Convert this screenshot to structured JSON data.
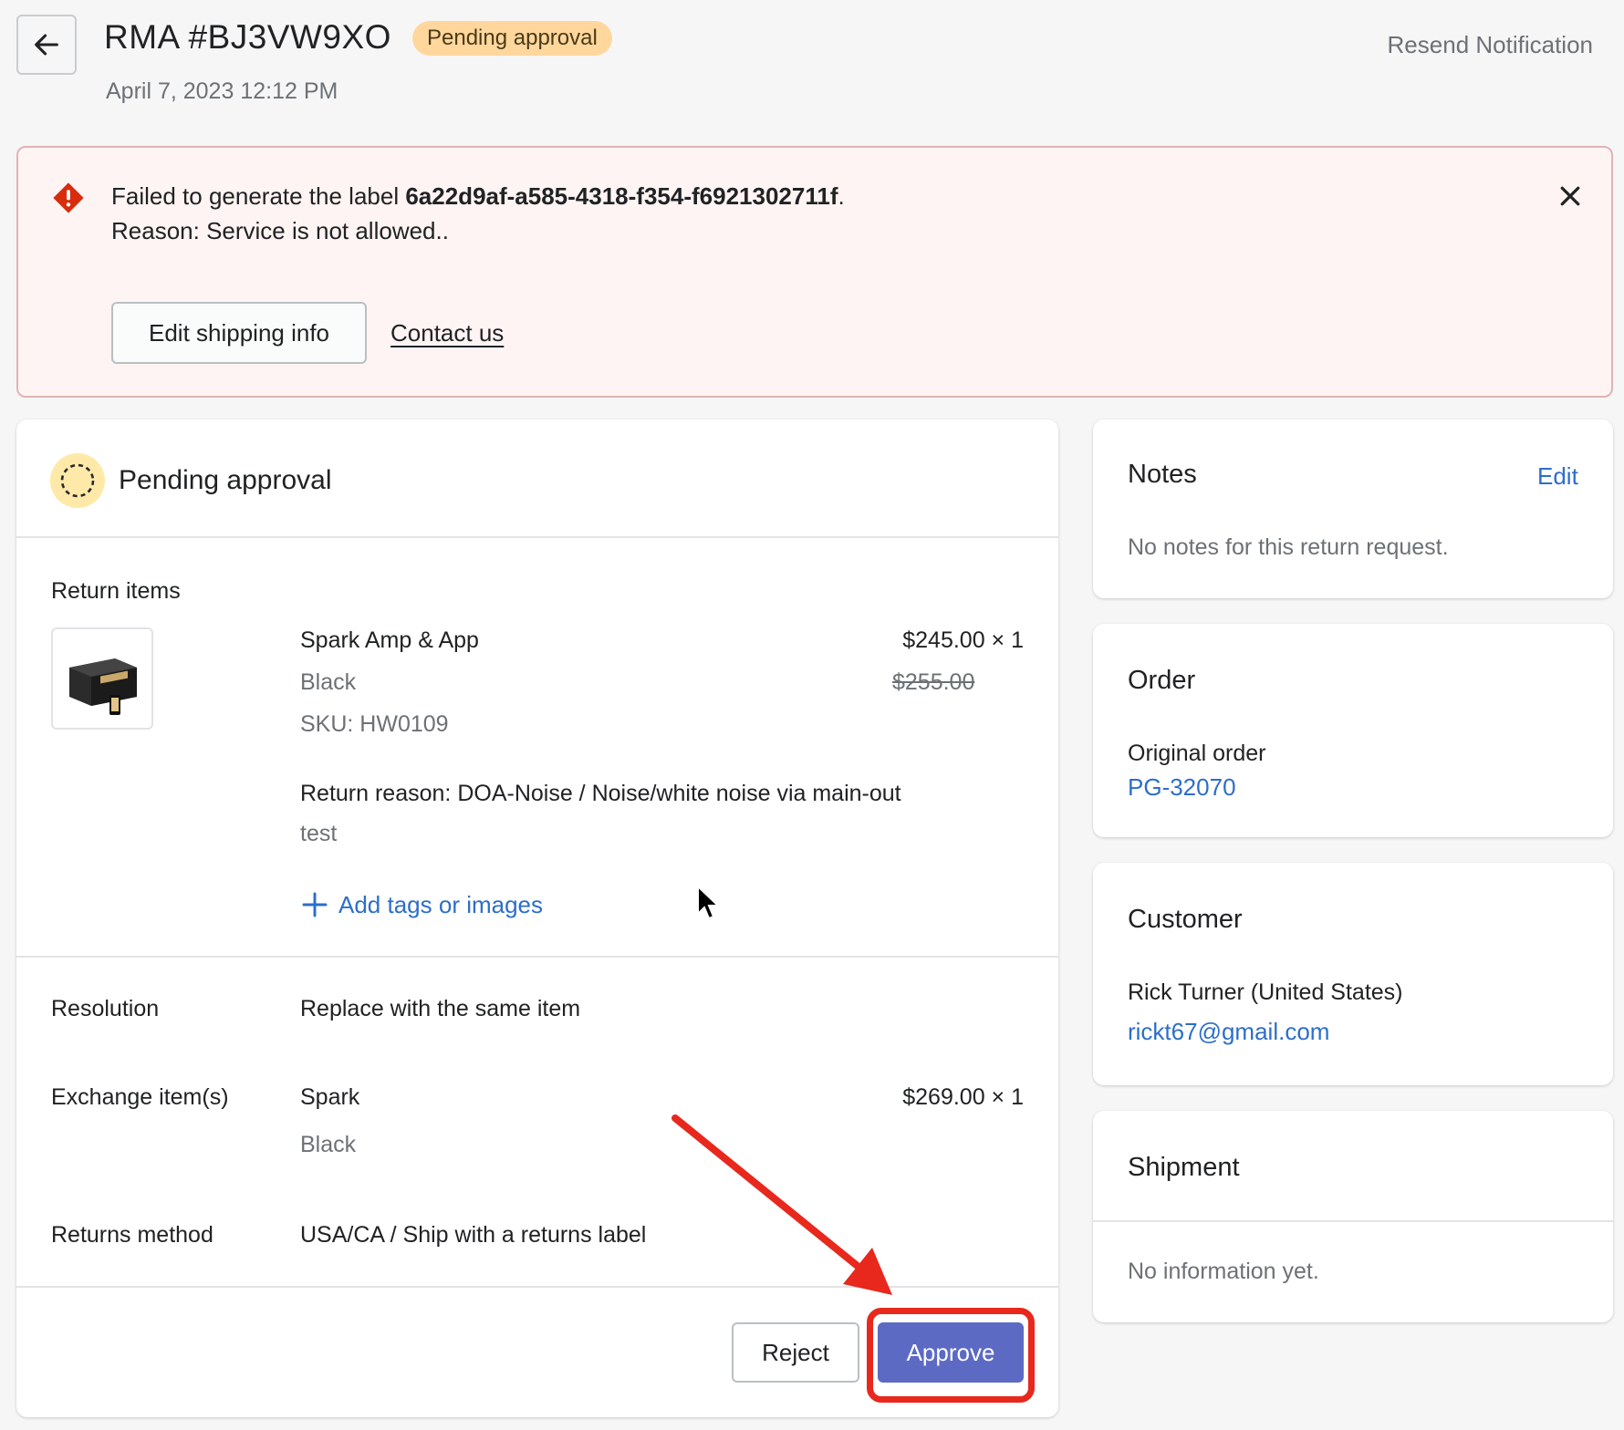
{
  "header": {
    "title": "RMA #BJ3VW9XO",
    "status_badge": "Pending approval",
    "date": "April 7, 2023 12:12 PM",
    "resend_label": "Resend Notification"
  },
  "banner": {
    "line1_prefix": "Failed to generate the label ",
    "label_id": "6a22d9af-a585-4318-f354-f6921302711f",
    "line1_suffix": ".",
    "line2": "Reason: Service is not allowed..",
    "edit_button": "Edit shipping info",
    "contact_link": "Contact us"
  },
  "main": {
    "status_title": "Pending approval",
    "return_items_label": "Return items",
    "item": {
      "name": "Spark Amp & App",
      "variant": "Black",
      "sku": "SKU: HW0109",
      "price": "$245.00 × 1",
      "original_price": "$255.00",
      "return_reason": "Return reason: DOA-Noise / Noise/white noise via main-out",
      "note": "test",
      "add_tags_label": "Add tags or images"
    },
    "resolution_label": "Resolution",
    "resolution_value": "Replace with the same item",
    "exchange_label": "Exchange item(s)",
    "exchange_item": {
      "name": "Spark",
      "variant": "Black",
      "price": "$269.00 × 1"
    },
    "returns_method_label": "Returns method",
    "returns_method_value": "USA/CA / Ship with a returns label",
    "reject_button": "Reject",
    "approve_button": "Approve"
  },
  "sidebar": {
    "notes": {
      "title": "Notes",
      "edit_link": "Edit",
      "body": "No notes for this return request."
    },
    "order": {
      "title": "Order",
      "original_label": "Original order",
      "order_link": "PG-32070"
    },
    "customer": {
      "title": "Customer",
      "name": "Rick Turner (United States)",
      "email": "rickt67@gmail.com"
    },
    "shipment": {
      "title": "Shipment",
      "body": "No information yet."
    }
  },
  "colors": {
    "badge_bg": "#ffd79d",
    "banner_bg": "#fff4f4",
    "error_icon": "#d82c0d",
    "link": "#2c6ecb",
    "primary_button": "#5c6ac4",
    "annotation": "#e8281d"
  },
  "icons": [
    "arrow-left-icon",
    "alert-diamond-icon",
    "close-icon",
    "pending-circle-icon",
    "plus-icon",
    "cursor-icon"
  ]
}
